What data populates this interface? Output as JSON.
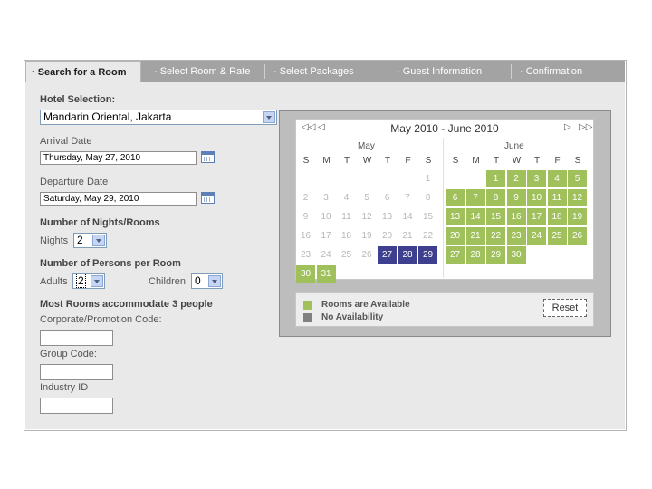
{
  "tabs": [
    {
      "label": "· Search for a Room"
    },
    {
      "label": "· Select Room & Rate"
    },
    {
      "label": "· Select Packages"
    },
    {
      "label": "· Guest Information"
    },
    {
      "label": "· Confirmation"
    }
  ],
  "form": {
    "hotel_label": "Hotel Selection:",
    "hotel_value": "Mandarin Oriental, Jakarta",
    "arrival_label": "Arrival Date",
    "arrival_value": "Thursday, May 27, 2010",
    "departure_label": "Departure Date",
    "departure_value": "Saturday, May 29, 2010",
    "nights_heading": "Number of Nights/Rooms",
    "nights_label": "Nights",
    "nights_value": "2",
    "persons_heading": "Number of Persons per Room",
    "adults_label": "Adults",
    "adults_value": "2",
    "children_label": "Children",
    "children_value": "0",
    "max_note": "Most Rooms accommodate 3 people",
    "promo_label": "Corporate/Promotion Code:",
    "group_label": "Group Code:",
    "industry_label": "Industry ID"
  },
  "calendar": {
    "title": "May 2010 - June 2010",
    "months": [
      "May",
      "June"
    ],
    "days_of_week": [
      "S",
      "M",
      "T",
      "W",
      "T",
      "F",
      "S"
    ],
    "may_rows": [
      [
        [
          "",
          ""
        ],
        [
          "",
          ""
        ],
        [
          "",
          ""
        ],
        [
          "",
          ""
        ],
        [
          "",
          ""
        ],
        [
          "",
          ""
        ],
        [
          "1",
          "x"
        ]
      ],
      [
        [
          "2",
          "x"
        ],
        [
          "3",
          "x"
        ],
        [
          "4",
          "x"
        ],
        [
          "5",
          "x"
        ],
        [
          "6",
          "x"
        ],
        [
          "7",
          "x"
        ],
        [
          "8",
          "x"
        ]
      ],
      [
        [
          "9",
          "x"
        ],
        [
          "10",
          "x"
        ],
        [
          "11",
          "x"
        ],
        [
          "12",
          "x"
        ],
        [
          "13",
          "x"
        ],
        [
          "14",
          "x"
        ],
        [
          "15",
          "x"
        ]
      ],
      [
        [
          "16",
          "x"
        ],
        [
          "17",
          "x"
        ],
        [
          "18",
          "x"
        ],
        [
          "19",
          "x"
        ],
        [
          "20",
          "x"
        ],
        [
          "21",
          "x"
        ],
        [
          "22",
          "x"
        ]
      ],
      [
        [
          "23",
          "x"
        ],
        [
          "24",
          "x"
        ],
        [
          "25",
          "x"
        ],
        [
          "26",
          "x"
        ],
        [
          "27",
          "n"
        ],
        [
          "28",
          "n"
        ],
        [
          "29",
          "n"
        ]
      ],
      [
        [
          "30",
          "g"
        ],
        [
          "31",
          "g"
        ]
      ]
    ],
    "june_rows": [
      [
        [
          "",
          ""
        ],
        [
          "",
          ""
        ],
        [
          "1",
          "g"
        ],
        [
          "2",
          "g"
        ],
        [
          "3",
          "g"
        ],
        [
          "4",
          "g"
        ],
        [
          "5",
          "g"
        ]
      ],
      [
        [
          "6",
          "g"
        ],
        [
          "7",
          "g"
        ],
        [
          "8",
          "g"
        ],
        [
          "9",
          "g"
        ],
        [
          "10",
          "g"
        ],
        [
          "11",
          "g"
        ],
        [
          "12",
          "g"
        ]
      ],
      [
        [
          "13",
          "g"
        ],
        [
          "14",
          "g"
        ],
        [
          "15",
          "g"
        ],
        [
          "16",
          "g"
        ],
        [
          "17",
          "g"
        ],
        [
          "18",
          "g"
        ],
        [
          "19",
          "g"
        ]
      ],
      [
        [
          "20",
          "g"
        ],
        [
          "21",
          "g"
        ],
        [
          "22",
          "g"
        ],
        [
          "23",
          "g"
        ],
        [
          "24",
          "g"
        ],
        [
          "25",
          "g"
        ],
        [
          "26",
          "g"
        ]
      ],
      [
        [
          "27",
          "g"
        ],
        [
          "28",
          "g"
        ],
        [
          "29",
          "g"
        ],
        [
          "30",
          "g"
        ]
      ]
    ],
    "legend_available": "Rooms are Available",
    "legend_unavailable": "No Availability",
    "reset_label": "Reset",
    "colors": {
      "available": "#a0c05c",
      "no_availability": "#808080",
      "selected": "#3f3f8f"
    }
  }
}
